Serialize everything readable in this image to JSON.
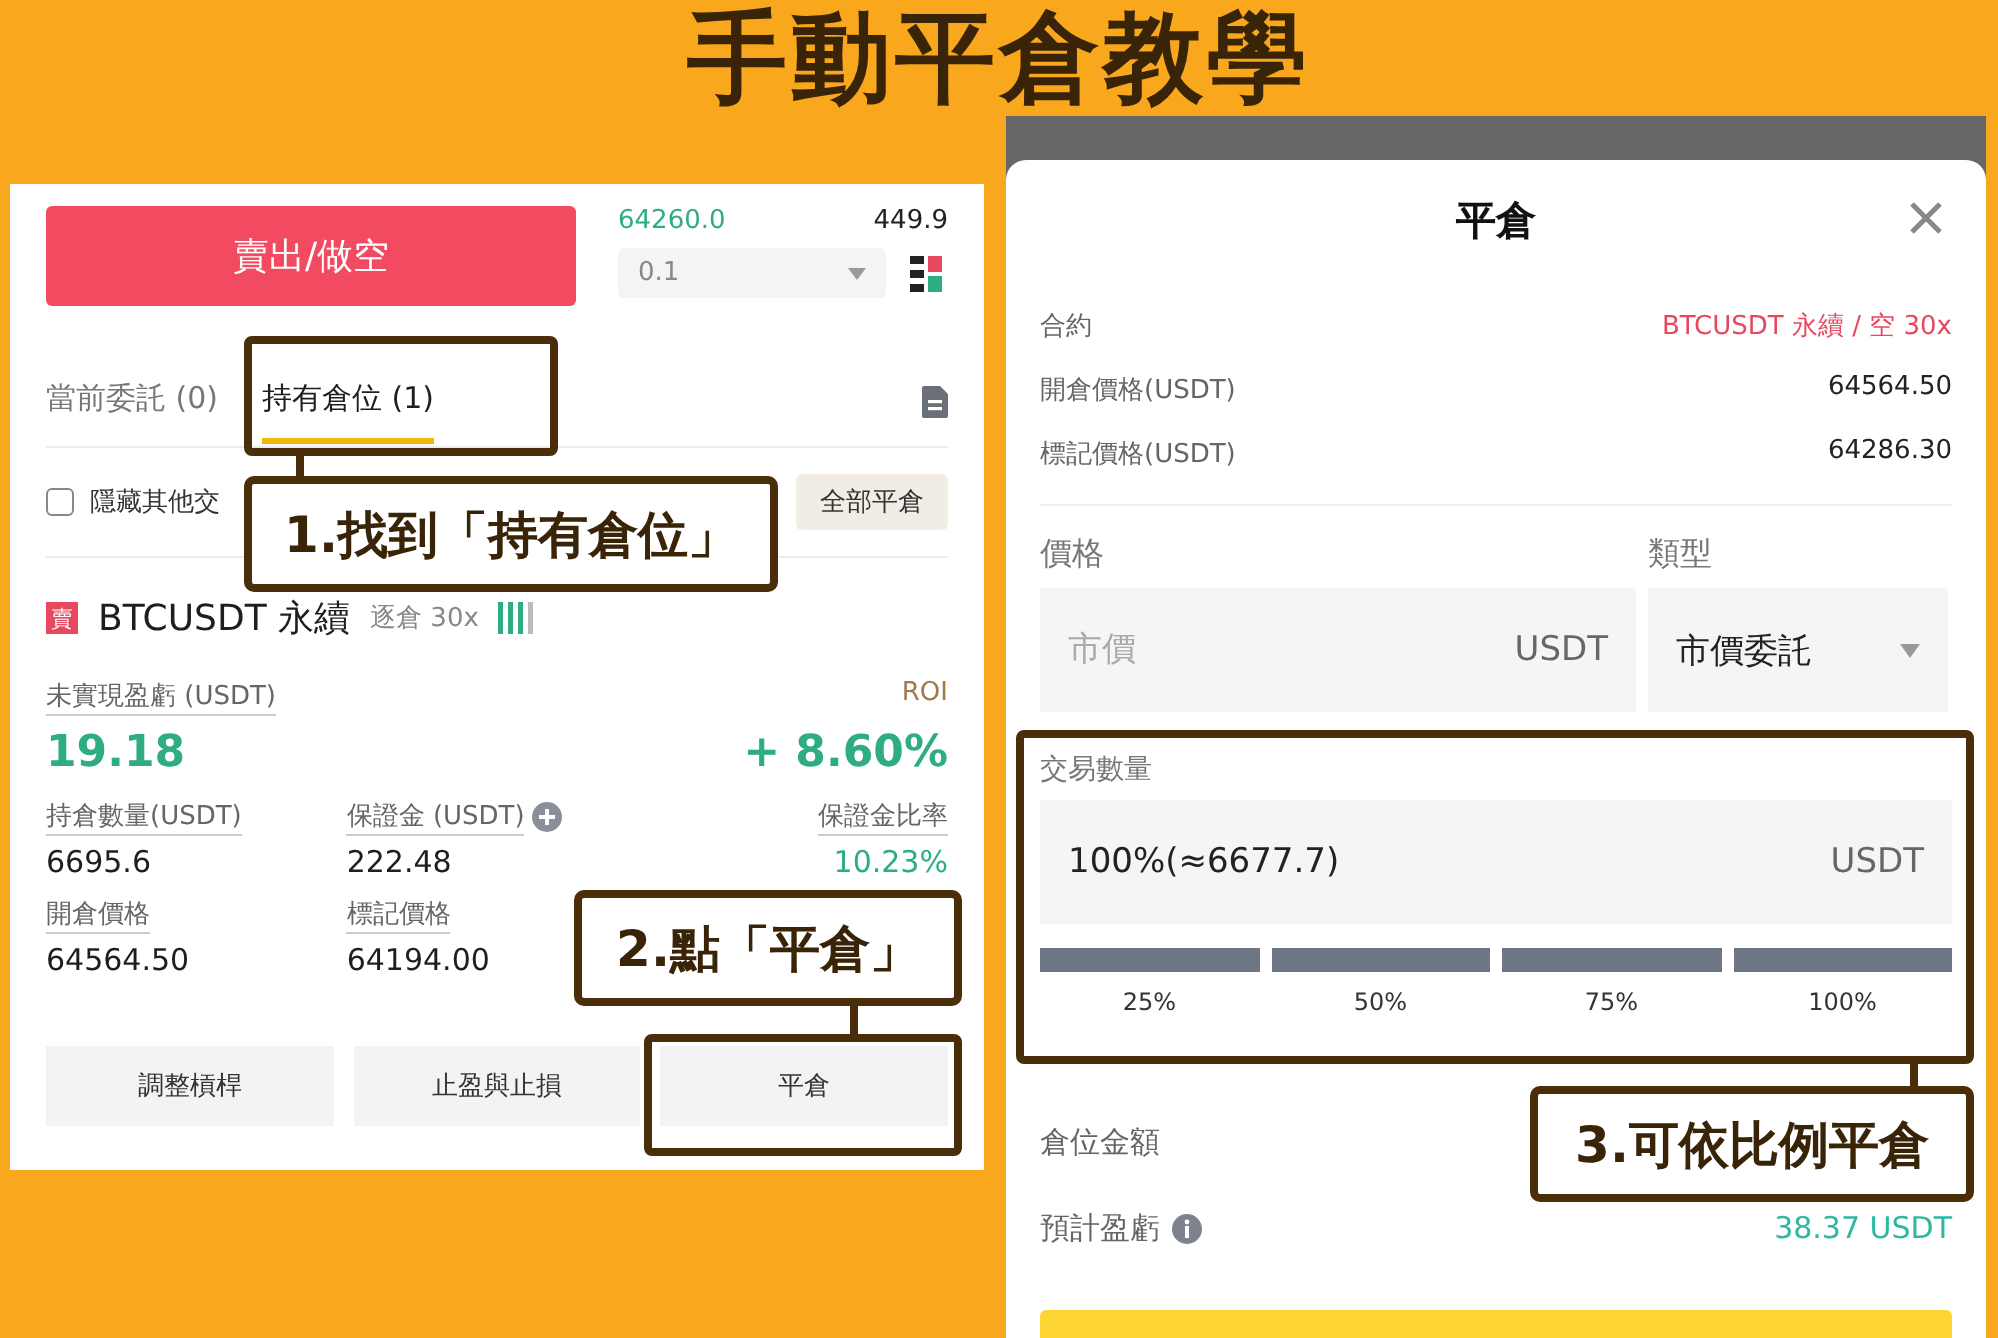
{
  "title": "手動平倉教學",
  "left_screen": {
    "order_book": [
      {
        "price": "64260.0",
        "amount": "449.9"
      }
    ],
    "sell_button": "賣出/做空",
    "depth_select": "0.1",
    "tabs": [
      {
        "label": "當前委託 (0)",
        "selected": false
      },
      {
        "label": "持有倉位 (1)",
        "selected": true
      }
    ],
    "hide_other": {
      "label": "隱藏其他交",
      "checked": false
    },
    "close_all_button": "全部平倉",
    "position": {
      "side_badge": "賣",
      "symbol": "BTCUSDT 永續",
      "margin_mode": "逐倉 30x",
      "pnl_label": "未實現盈虧 (USDT)",
      "roi_label": "ROI",
      "pnl": "19.18",
      "roi": "+ 8.60%",
      "stats": [
        {
          "label": "持倉數量(USDT)",
          "value": "6695.6",
          "addable": false
        },
        {
          "label": "保證金 (USDT)",
          "value": "222.48",
          "addable": true
        },
        {
          "label": "保證金比率",
          "value": "10.23%",
          "addable": false
        },
        {
          "label": "開倉價格",
          "value": "64564.50",
          "addable": false
        },
        {
          "label": "標記價格",
          "value": "64194.00",
          "addable": false
        }
      ]
    },
    "actions": [
      "調整槓桿",
      "止盈與止損",
      "平倉"
    ]
  },
  "right_screen": {
    "title": "平倉",
    "info_rows": [
      {
        "label": "合約",
        "value": "BTCUSDT 永續 / 空 30x",
        "kind": "contract"
      },
      {
        "label": "開倉價格(USDT)",
        "value": "64564.50",
        "kind": "price"
      },
      {
        "label": "標記價格(USDT)",
        "value": "64286.30",
        "kind": "price"
      }
    ],
    "price": {
      "label": "價格",
      "placeholder": "市價",
      "unit": "USDT"
    },
    "type": {
      "label": "類型",
      "value": "市價委託"
    },
    "quantity": {
      "label": "交易數量",
      "value": "100%(≈6677.7)",
      "unit": "USDT",
      "level": 1,
      "steps": [
        "25%",
        "50%",
        "75%",
        "100%"
      ]
    },
    "position_value_label": "倉位金額",
    "estimated_pnl": {
      "label": "預計盈虧",
      "value": "38.37 USDT"
    }
  },
  "callouts": [
    {
      "text": "1.找到「持有倉位」"
    },
    {
      "text": "2.點「平倉」"
    },
    {
      "text": "3.可依比例平倉"
    }
  ]
}
